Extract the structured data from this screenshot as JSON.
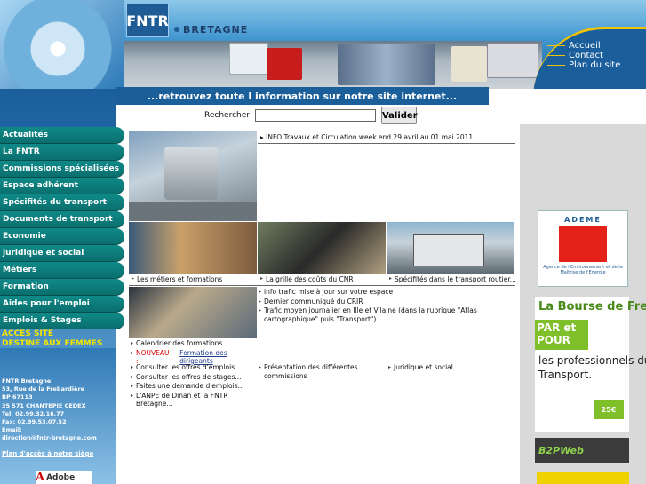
{
  "header": {
    "logo_text": "FNTR",
    "logo_sub": "BRETAGNE",
    "banner": "...retrouvez toute l information sur notre site internet...",
    "topnav": [
      "Accueil",
      "Contact",
      "Plan du site"
    ]
  },
  "search": {
    "label": "Rechercher",
    "value": "",
    "button": "Valider"
  },
  "sidebar": {
    "items": [
      "Actualités",
      "La FNTR",
      "Commissions spécialisées",
      "Espace adhérent",
      "Spécifités du transport",
      "Documents de transport",
      "Economie",
      "juridique et social",
      "Métiers",
      "Formation",
      "Aides pour l'emploi",
      "Emplois & Stages"
    ],
    "access_line1": "ACCES SITE",
    "access_line2": "DESTINE AUX FEMMES",
    "address": {
      "line1": "FNTR Bretagne",
      "line2": "53, Rue de la Frebardière",
      "line3": "BP 67113",
      "line4": "35 571 CHANTEPIE CEDEX",
      "tel": "Tel: 02.99.32.16.77",
      "fax": "Fax: 02.99.53.07.52",
      "email_label": "Email:",
      "email": "direction@fntr-bretagne.com"
    },
    "plan": "Plan d'accès à notre siège",
    "adobe": "Adobe"
  },
  "news": {
    "headline": "INFO Travaux et Circulation week end 29 avril au 01 mai 2011"
  },
  "captions": {
    "metiers": "Les métiers et formations",
    "cnr": "La grille des coûts du CNR",
    "specificites": "Spécifités dans le transport routier..."
  },
  "info_list": [
    "info trafic mise à jour sur votre espace",
    "Dernier communiqué du CRIR",
    "Trafic moyen journalier en Ille et Vilaine (dans la rubrique \"Atlas cartographique\" puis \"Transport\")"
  ],
  "formation_list": {
    "item1": "Calendrier des formations...",
    "new_label": "NOUVEAU :",
    "new_link": "Formation des dirigeants"
  },
  "emploi_list": [
    "Consulter les offres d'emplois...",
    "Consulter les offres de stages...",
    "Faites une demande d'emplois...",
    "L'ANPE de Dinan et la FNTR Bretagne..."
  ],
  "commissions": "Présentation des différentes commissions",
  "juridique": "Juridique et social",
  "ads": {
    "ademe_title": "ADEME",
    "ademe_sub": "Agence de l'Environnement et de la Maîtrise de l'Energie",
    "bourse_l1": "La Bourse de Fret",
    "bourse_l2": "PAR et POUR",
    "bourse_l3": "les professionnels du Transport.",
    "bourse_price": "25€",
    "b2p": "B2PWeb"
  }
}
